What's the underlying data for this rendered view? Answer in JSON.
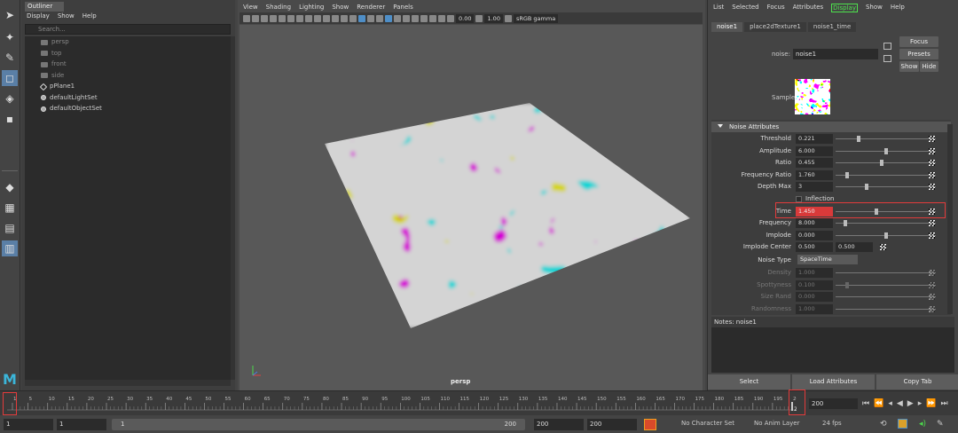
{
  "outliner": {
    "tab": "Outliner",
    "menu": [
      "Display",
      "Show",
      "Help"
    ],
    "search_placeholder": "Search...",
    "items": [
      {
        "label": "persp",
        "kind": "camera",
        "dim": true
      },
      {
        "label": "top",
        "kind": "camera",
        "dim": true
      },
      {
        "label": "front",
        "kind": "camera",
        "dim": true
      },
      {
        "label": "side",
        "kind": "camera",
        "dim": true
      },
      {
        "label": "pPlane1",
        "kind": "mesh",
        "dim": false
      },
      {
        "label": "defaultLightSet",
        "kind": "set",
        "dim": false
      },
      {
        "label": "defaultObjectSet",
        "kind": "set",
        "dim": false
      }
    ]
  },
  "viewport": {
    "menu": [
      "View",
      "Shading",
      "Lighting",
      "Show",
      "Renderer",
      "Panels"
    ],
    "exposure": "0.00",
    "gamma": "1.00",
    "color_space": "sRGB gamma",
    "camera_label": "persp"
  },
  "attr": {
    "menu": [
      "List",
      "Selected",
      "Focus",
      "Attributes",
      "Display",
      "Show",
      "Help"
    ],
    "menu_highlight": "Display",
    "tabs": [
      "noise1",
      "place2dTexture1",
      "noise1_time"
    ],
    "node_label": "noise:",
    "node_name": "noise1",
    "focus_label": "Focus",
    "presets_label": "Presets",
    "show_label": "Show",
    "hide_label": "Hide",
    "sample_label": "Sample",
    "section_title": "Noise Attributes",
    "rows": [
      {
        "label": "Threshold",
        "value": "0.221",
        "pos": 0.221
      },
      {
        "label": "Amplitude",
        "value": "6.000",
        "pos": 0.5
      },
      {
        "label": "Ratio",
        "value": "0.455",
        "pos": 0.455
      },
      {
        "label": "Frequency Ratio",
        "value": "1.760",
        "pos": 0.1
      },
      {
        "label": "Depth Max",
        "value": "3",
        "pos": 0.3
      }
    ],
    "inflection_label": "Inflection",
    "time": {
      "label": "Time",
      "value": "1.450",
      "pos": 0.4
    },
    "rows2": [
      {
        "label": "Frequency",
        "value": "8.000",
        "pos": 0.08
      },
      {
        "label": "Implode",
        "value": "0.000",
        "pos": 0.5
      }
    ],
    "implode_center": {
      "label": "Implode Center",
      "x": "0.500",
      "y": "0.500"
    },
    "noise_type": {
      "label": "Noise Type",
      "value": "SpaceTime"
    },
    "dim_rows": [
      {
        "label": "Density",
        "value": "1.000",
        "pos": 0.95
      },
      {
        "label": "Spottyness",
        "value": "0.100",
        "pos": 0.1
      },
      {
        "label": "Size Rand",
        "value": "0.000",
        "pos": 0.95
      },
      {
        "label": "Randomness",
        "value": "1.000",
        "pos": 0.95
      }
    ],
    "notes_label": "Notes:  noise1",
    "buttons": [
      "Select",
      "Load Attributes",
      "Copy Tab"
    ]
  },
  "timeline": {
    "ticks": [
      "1",
      "5",
      "10",
      "15",
      "20",
      "25",
      "30",
      "35",
      "40",
      "45",
      "50",
      "55",
      "60",
      "65",
      "70",
      "75",
      "80",
      "85",
      "90",
      "95",
      "100",
      "105",
      "110",
      "115",
      "120",
      "125",
      "130",
      "135",
      "140",
      "145",
      "150",
      "155",
      "160",
      "165",
      "170",
      "175",
      "180",
      "185",
      "190",
      "195",
      "200"
    ],
    "current_frame": "200",
    "frame_field": "200"
  },
  "range": {
    "start": "1",
    "start2": "1",
    "bar_start": "1",
    "bar_end": "200",
    "end": "200",
    "end2": "200",
    "character_set": "No Character Set",
    "anim_layer": "No Anim Layer",
    "fps": "24 fps"
  },
  "colors": {
    "accent": "#5a7fa6",
    "highlight": "#e23b3b",
    "display_menu": "#4de34d"
  }
}
